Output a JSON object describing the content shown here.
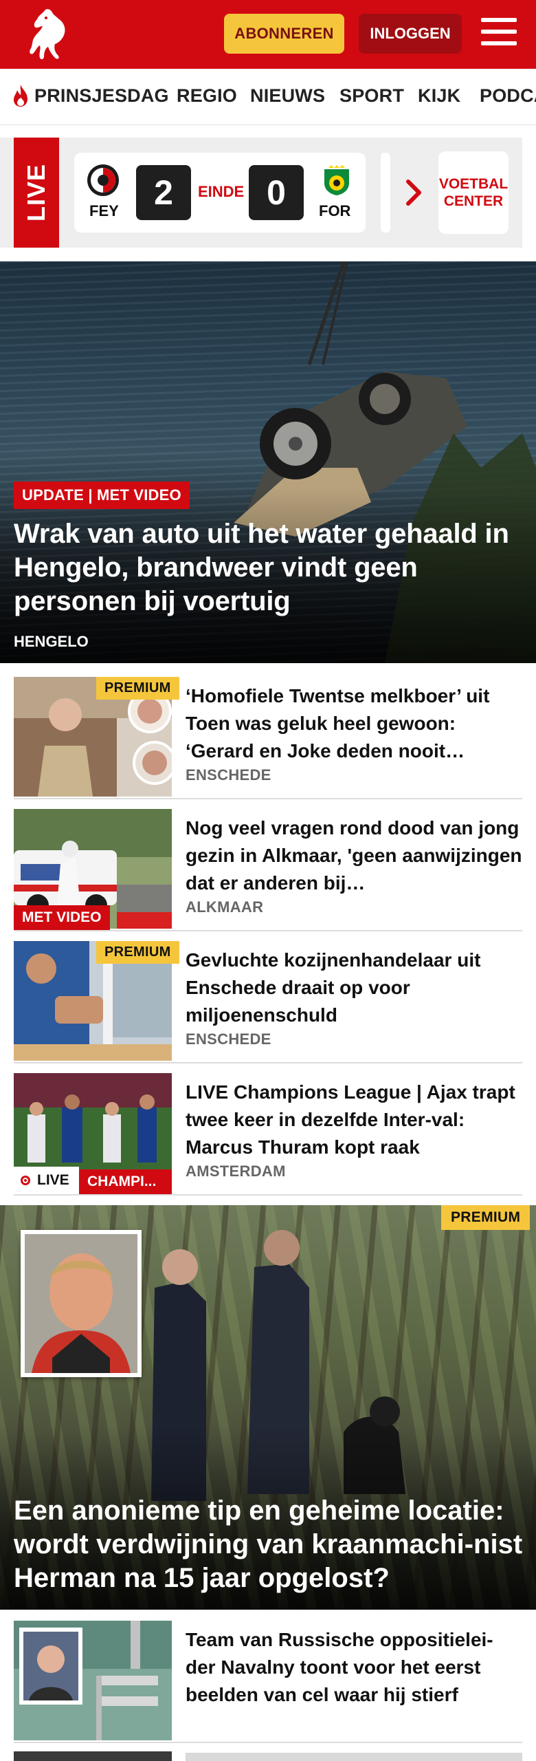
{
  "header": {
    "subscribe_label": "ABONNEREN",
    "login_label": "INLOGGEN",
    "menu_icon": "hamburger-icon",
    "logo_icon": "horse-logo-icon",
    "brand_color": "#d10a11",
    "subscribe_color": "#f5c63c"
  },
  "nav": {
    "items": [
      {
        "label": "PRINSJESDAG",
        "icon": "flame-icon"
      },
      {
        "label": "REGIO"
      },
      {
        "label": "NIEUWS"
      },
      {
        "label": "SPORT"
      },
      {
        "label": "KIJK"
      },
      {
        "label": "PODCA"
      }
    ]
  },
  "live": {
    "tag": "LIVE",
    "match": {
      "home": "FEY",
      "home_score": "2",
      "status": "EINDE",
      "away_score": "0",
      "away": "FOR"
    },
    "voetbal_center": "VOETBAL CENTER"
  },
  "hero": {
    "badge": "UPDATE | MET VIDEO",
    "title": "Wrak van auto uit het water gehaald in Hengelo, brandweer vindt geen personen bij voertuig",
    "location": "HENGELO"
  },
  "articles": [
    {
      "title": "‘Homofiele Twentse melkboer’ uit Toen was geluk heel gewoon: ‘Gerard en Joke deden nooit…",
      "location": "ENSCHEDE",
      "badge": "PREMIUM"
    },
    {
      "title": "Nog veel vragen rond dood van jong gezin in Alkmaar, 'geen aanwijzingen dat er anderen bij…",
      "location": "ALKMAAR",
      "badge": "MET VIDEO"
    },
    {
      "title": "Gevluchte kozijnenhandelaar uit Enschede draait op voor miljoenenschuld",
      "location": "ENSCHEDE",
      "badge": "PREMIUM"
    },
    {
      "title": "LIVE Champions League | Ajax trapt twee keer in dezelfde Inter-val: Marcus Thuram kopt raak",
      "location": "AMSTERDAM",
      "live_label": "LIVE",
      "badge": "CHAMPI..."
    }
  ],
  "feature": {
    "badge": "PREMIUM",
    "title": "Een anonieme tip en geheime locatie: wordt verdwijning van kraanmachi-nist Herman na 15 jaar opgelost?"
  },
  "articles2": [
    {
      "title": "Team van Russische oppositielei-der Navalny toont voor het eerst beelden van cel waar hij stierf"
    }
  ]
}
